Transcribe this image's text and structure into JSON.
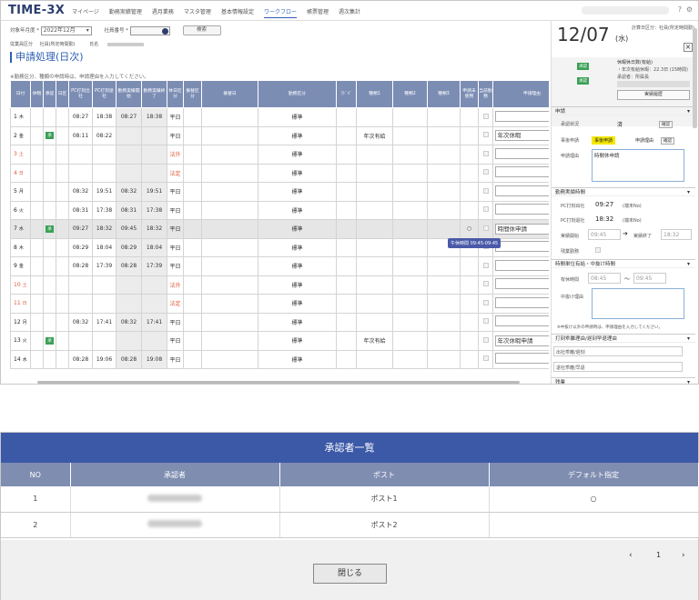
{
  "header": {
    "logo": "TIME-3X",
    "nav": [
      "マイページ",
      "勤務実績管理",
      "週月業務",
      "マスタ管理",
      "基本情報設定",
      "ワークフロー",
      "帳票管理",
      "週次集計"
    ],
    "active_nav": "ワークフロー",
    "user": "xxxxxx xxxxx",
    "help_icon": "help-icon",
    "settings_icon": "gear-icon"
  },
  "filter": {
    "month_label": "対象年月度 *",
    "month_value": "2022年12月",
    "emp_label": "社員番号 *",
    "search": "検索"
  },
  "employee": {
    "label1": "従業員区分",
    "val1": "社員(所定時間勤)",
    "label2": "氏名"
  },
  "page_title": "申請処理(日次)",
  "note": "※勤務区分、種類の申請時は、申請理由を入力してください。",
  "grid": {
    "headers": [
      "日付",
      "休暇",
      "承認",
      "日区",
      "PC打刻出社",
      "PC打刻退社",
      "勤務実績開始",
      "勤務実績終了",
      "休日区分",
      "振替区分",
      "振替日",
      "勤務区分",
      "ｱﾄﾞﾊﾞ",
      "種類1",
      "種類2",
      "種類3",
      "申請未使用",
      "当該勤務",
      "申請理由"
    ],
    "rows": [
      {
        "d": "1",
        "w": "木",
        "r": false,
        "a": "",
        "pi": "08:27",
        "po": "18:38",
        "ws": "08:27",
        "we": "18:38",
        "hk": "平日",
        "kbn": "標準",
        "s1": "",
        "reason": "",
        "hl": false
      },
      {
        "d": "2",
        "w": "金",
        "r": false,
        "a": "承",
        "pi": "08:11",
        "po": "08:22",
        "ws": "",
        "we": "",
        "hk": "平日",
        "kbn": "標準",
        "s1": "年次有給",
        "reason": "年次休暇",
        "hl": false
      },
      {
        "d": "3",
        "w": "土",
        "r": true,
        "a": "",
        "pi": "",
        "po": "",
        "ws": "",
        "we": "",
        "hk": "法外",
        "kbn": "標準",
        "s1": "",
        "reason": "",
        "hl": false
      },
      {
        "d": "4",
        "w": "日",
        "r": true,
        "a": "",
        "pi": "",
        "po": "",
        "ws": "",
        "we": "",
        "hk": "法定",
        "kbn": "標準",
        "s1": "",
        "reason": "",
        "hl": false
      },
      {
        "d": "5",
        "w": "月",
        "r": false,
        "a": "",
        "pi": "08:32",
        "po": "19:51",
        "ws": "08:32",
        "we": "19:51",
        "hk": "平日",
        "kbn": "標準",
        "s1": "",
        "reason": "",
        "hl": false
      },
      {
        "d": "6",
        "w": "火",
        "r": false,
        "a": "",
        "pi": "08:31",
        "po": "17:38",
        "ws": "08:31",
        "we": "17:38",
        "hk": "平日",
        "kbn": "標準",
        "s1": "",
        "reason": "",
        "hl": false
      },
      {
        "d": "7",
        "w": "水",
        "r": false,
        "a": "承",
        "pi": "09:27",
        "po": "18:32",
        "ws": "09:45",
        "we": "18:32",
        "hk": "平日",
        "kbn": "標準",
        "s1": "",
        "reason": "時間休申請",
        "hl": true
      },
      {
        "d": "8",
        "w": "木",
        "r": false,
        "a": "",
        "pi": "08:29",
        "po": "18:04",
        "ws": "08:29",
        "we": "18:04",
        "hk": "平日",
        "kbn": "標準",
        "s1": "",
        "reason": "",
        "hl": false
      },
      {
        "d": "9",
        "w": "金",
        "r": false,
        "a": "",
        "pi": "08:28",
        "po": "17:39",
        "ws": "08:28",
        "we": "17:39",
        "hk": "平日",
        "kbn": "標準",
        "s1": "",
        "reason": "",
        "hl": false
      },
      {
        "d": "10",
        "w": "土",
        "r": true,
        "a": "",
        "pi": "",
        "po": "",
        "ws": "",
        "we": "",
        "hk": "法外",
        "kbn": "標準",
        "s1": "",
        "reason": "",
        "hl": false
      },
      {
        "d": "11",
        "w": "日",
        "r": true,
        "a": "",
        "pi": "",
        "po": "",
        "ws": "",
        "we": "",
        "hk": "法定",
        "kbn": "標準",
        "s1": "",
        "reason": "",
        "hl": false
      },
      {
        "d": "12",
        "w": "月",
        "r": false,
        "a": "",
        "pi": "08:32",
        "po": "17:41",
        "ws": "08:32",
        "we": "17:41",
        "hk": "平日",
        "kbn": "標準",
        "s1": "",
        "reason": "",
        "hl": false
      },
      {
        "d": "13",
        "w": "火",
        "r": false,
        "a": "承",
        "pi": "",
        "po": "",
        "ws": "",
        "we": "",
        "hk": "平日",
        "kbn": "標準",
        "s1": "年次有給",
        "reason": "年次休暇申請",
        "hl": false
      },
      {
        "d": "14",
        "w": "水",
        "r": false,
        "a": "",
        "pi": "08:28",
        "po": "19:06",
        "ws": "08:28",
        "we": "19:08",
        "hk": "平日",
        "kbn": "標準",
        "s1": "",
        "reason": "",
        "hl": false
      }
    ],
    "tooltip": "午休時間 09:45-09:45",
    "row7_mark": "○"
  },
  "side": {
    "date": "12/07",
    "dow": "(水)",
    "type": "計算日区分：社員(所定時間勤)",
    "badge1": "承認",
    "badge2": "承認",
    "info1": "休暇休日数(有給)",
    "info2": "・年次有給休暇：22.3日 (15時間)",
    "info3": "承認者：所属長",
    "history": "実績履歴",
    "sec_apply": "申請",
    "status_label": "承認状況",
    "status": "済",
    "status_btn": "確認",
    "jijo_label": "事後申請",
    "jijo_val": "事後申請",
    "reason_type_label": "申請理由",
    "reason_type_btn": "確認",
    "reason_label": "申請理由",
    "reason_text": "時間休申請",
    "sec_work": "勤務実績時間",
    "pcin_label": "PC打刻出社",
    "pcin": "09:27",
    "pcin_note": "(端末No)",
    "pcout_label": "PC打刻退社",
    "pcout": "18:32",
    "pcout_note": "(端末No)",
    "start_label": "実績開始",
    "start": "09:45",
    "end_label": "実績終了",
    "end": "18:32",
    "ot_label": "残業勤務",
    "sec_timeoff": "時間単位有給・中抜け時間",
    "to_label": "有休時間",
    "to_from": "08:45",
    "to_to": "09:45",
    "nuke_label": "中抜け理由",
    "note2": "※中抜け以外の申請時は、申請理由を入力してください。",
    "sec_late": "打刻乖離理由/遅刻早退理由",
    "late1": "出社乖離/遅刻",
    "late2": "退社乖離/早退",
    "sec_other": "残業"
  },
  "modal": {
    "title": "承認者一覧",
    "headers": [
      "NO",
      "承認者",
      "ポスト",
      "デフォルト指定"
    ],
    "rows": [
      {
        "no": "1",
        "post": "ポスト1",
        "def": "○"
      },
      {
        "no": "2",
        "post": "ポスト2",
        "def": ""
      }
    ],
    "page": "1",
    "prev": "‹",
    "next": "›",
    "close": "閉じる"
  }
}
